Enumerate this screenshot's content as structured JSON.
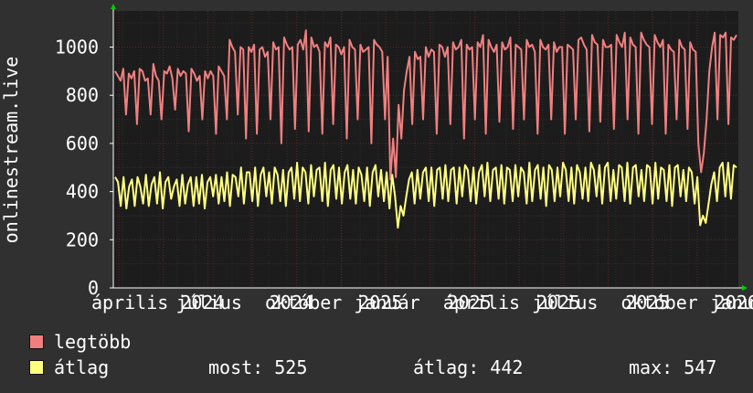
{
  "colors": {
    "background": "#303030",
    "plot_background": "#1c1c1c",
    "grid": "#5a2a2a",
    "axis": "#ffffff",
    "text": "#ffffff",
    "max_series": "#f08080",
    "avg_series": "#ffff80",
    "arrow": "#00cc00"
  },
  "chart_data": {
    "type": "line",
    "ylabel": "onlinestream.live",
    "ylim": [
      0,
      1150
    ],
    "yticks": [
      0,
      200,
      400,
      600,
      800,
      1000
    ],
    "x_tick_labels": [
      "április",
      "július",
      "2024",
      "október",
      "2024",
      "január",
      "2025",
      "április",
      "2025",
      "július",
      "2025",
      "október",
      "2025",
      "január",
      "2026"
    ],
    "grid": true,
    "series": [
      {
        "name": "legtöbb",
        "color": "#f08080",
        "values": [
          900,
          880,
          860,
          910,
          720,
          890,
          870,
          900,
          680,
          910,
          900,
          860,
          870,
          720,
          930,
          880,
          860,
          700,
          900,
          890,
          920,
          870,
          740,
          910,
          880,
          900,
          890,
          650,
          910,
          890,
          860,
          880,
          700,
          900,
          870,
          900,
          880,
          640,
          920,
          900,
          880,
          700,
          1030,
          1000,
          980,
          720,
          1000,
          990,
          620,
          1000,
          980,
          1010,
          640,
          990,
          1000,
          960,
          980,
          700,
          1020,
          990,
          1000,
          600,
          1040,
          1010,
          990,
          1000,
          660,
          1010,
          1030,
          990,
          1070,
          650,
          1040,
          1000,
          1010,
          980,
          640,
          1020,
          1000,
          1040,
          680,
          1010,
          1000,
          970,
          1000,
          620,
          1030,
          1000,
          990,
          700,
          1010,
          980,
          990,
          1000,
          600,
          1030,
          1010,
          1000,
          980,
          700,
          960,
          450,
          620,
          460,
          760,
          620,
          820,
          900,
          960,
          680,
          980,
          950,
          960,
          700,
          1000,
          960,
          990,
          980,
          640,
          1010,
          1000,
          960,
          1000,
          680,
          1020,
          990,
          1000,
          1030,
          620,
          1010,
          990,
          1000,
          700,
          1020,
          1000,
          1050,
          640,
          1030,
          1000,
          980,
          1010,
          690,
          1020,
          990,
          1000,
          1040,
          660,
          1010,
          1000,
          990,
          700,
          1030,
          1000,
          1010,
          980,
          640,
          1030,
          1000,
          990,
          1010,
          700,
          1020,
          980,
          1000,
          1000,
          640,
          1010,
          1000,
          990,
          700,
          1030,
          1040,
          1010,
          990,
          650,
          1050,
          1020,
          1010,
          690,
          1030,
          1000,
          1000,
          1010,
          660,
          1050,
          1020,
          1000,
          1060,
          700,
          1040,
          1010,
          1000,
          640,
          1060,
          1030,
          1010,
          1000,
          680,
          1050,
          1020,
          1000,
          1030,
          640,
          1010,
          990,
          980,
          700,
          1030,
          1000,
          990,
          660,
          1020,
          990,
          980,
          600,
          480,
          560,
          700,
          900,
          1000,
          1060,
          700,
          1050,
          1040,
          1060,
          680,
          1040,
          1030,
          1050
        ],
        "stats": {
          "most": null,
          "atlag": null,
          "max": null
        }
      },
      {
        "name": "átlag",
        "color": "#ffff80",
        "values": [
          460,
          440,
          340,
          460,
          330,
          420,
          450,
          340,
          460,
          420,
          350,
          470,
          340,
          430,
          460,
          350,
          480,
          330,
          440,
          460,
          370,
          420,
          450,
          340,
          470,
          350,
          430,
          460,
          340,
          460,
          350,
          470,
          330,
          440,
          460,
          380,
          470,
          350,
          460,
          360,
          480,
          340,
          470,
          460,
          380,
          500,
          350,
          480,
          480,
          360,
          500,
          340,
          470,
          500,
          380,
          480,
          350,
          500,
          470,
          360,
          490,
          340,
          480,
          500,
          370,
          520,
          360,
          500,
          480,
          350,
          510,
          380,
          490,
          500,
          360,
          520,
          340,
          490,
          510,
          370,
          500,
          350,
          480,
          510,
          370,
          490,
          350,
          500,
          470,
          360,
          500,
          340,
          480,
          510,
          380,
          490,
          360,
          480,
          330,
          470,
          380,
          250,
          340,
          300,
          380,
          450,
          480,
          350,
          490,
          370,
          480,
          500,
          360,
          500,
          340,
          490,
          500,
          370,
          510,
          360,
          490,
          500,
          350,
          500,
          380,
          510,
          490,
          360,
          500,
          350,
          480,
          510,
          380,
          520,
          360,
          490,
          500,
          370,
          510,
          350,
          500,
          490,
          360,
          510,
          380,
          500,
          480,
          350,
          520,
          360,
          490,
          510,
          370,
          500,
          340,
          510,
          490,
          360,
          500,
          380,
          520,
          490,
          360,
          500,
          350,
          510,
          480,
          370,
          500,
          360,
          520,
          490,
          380,
          510,
          350,
          500,
          520,
          360,
          490,
          370,
          510,
          500,
          360,
          520,
          350,
          500,
          510,
          380,
          490,
          360,
          510,
          500,
          350,
          520,
          370,
          500,
          490,
          360,
          510,
          340,
          500,
          510,
          380,
          490,
          360,
          500,
          480,
          350,
          460,
          260,
          300,
          270,
          350,
          430,
          480,
          360,
          500,
          520,
          380,
          520,
          370,
          510,
          500
        ],
        "stats": {
          "most": "525",
          "atlag": "442",
          "max": "547"
        }
      }
    ]
  },
  "legend": {
    "items": [
      {
        "label": "legtöbb"
      },
      {
        "label": "átlag"
      }
    ],
    "stats": {
      "most_label": "most:",
      "most_value": "525",
      "atlag_label": "átlag:",
      "atlag_value": "442",
      "max_label": "max:",
      "max_value": "547"
    }
  }
}
